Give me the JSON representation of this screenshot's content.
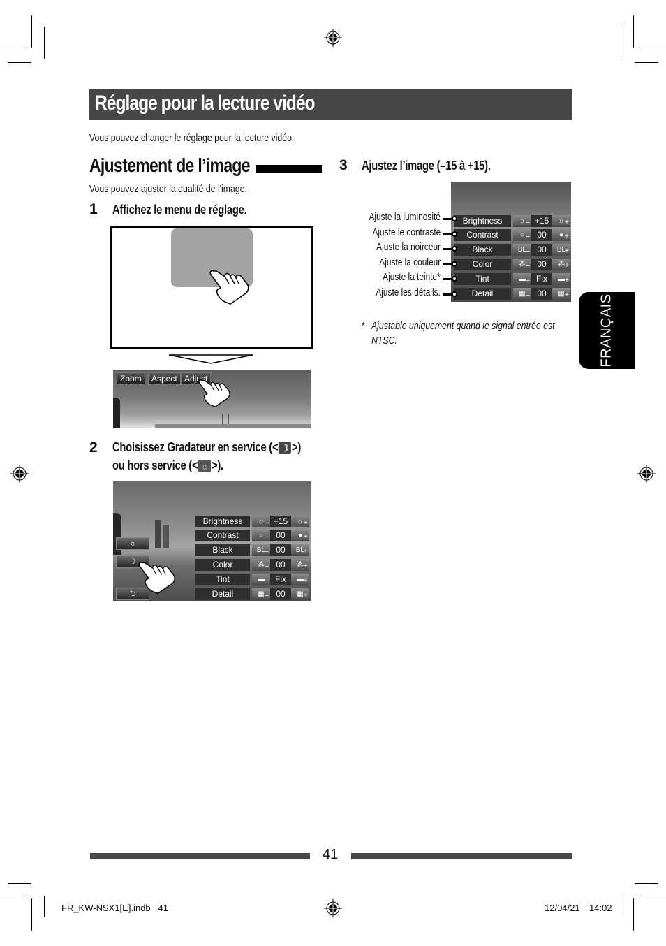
{
  "page": {
    "title": "Réglage pour la lecture vidéo",
    "intro": "Vous pouvez changer le réglage pour la lecture vidéo.",
    "language_tab": "FRANÇAIS",
    "page_number": "41"
  },
  "section": {
    "title": "Ajustement de l’image",
    "intro": "Vous pouvez ajuster la qualité de l'image."
  },
  "steps": [
    {
      "number": "1",
      "text": "Affichez le menu de réglage."
    },
    {
      "number": "2",
      "text_line1_a": "Choisissez Gradateur en service (<",
      "text_line1_b": ">)",
      "text_line2_a": "ou hors service (<",
      "text_line2_b": ">)."
    },
    {
      "number": "3",
      "text": "Ajustez l’image (–15 à +15)."
    }
  ],
  "step1_illustration": {
    "buttons": [
      "Zoom",
      "Aspect",
      "Adjust"
    ]
  },
  "adjust_menu": {
    "rows": [
      {
        "label": "Brightness",
        "minus_icon": "sun-dim-icon",
        "value": "+15",
        "plus_icon": "sun-bright-icon",
        "minus_glyph": "☼",
        "plus_glyph": "☼"
      },
      {
        "label": "Contrast",
        "minus_icon": "circle-outline-icon",
        "value": "00",
        "plus_icon": "circle-filled-icon",
        "minus_glyph": "○",
        "plus_glyph": "●"
      },
      {
        "label": "Black",
        "minus_icon": "bl-dark-icon",
        "value": "00",
        "plus_icon": "bl-light-icon",
        "minus_glyph": "BL",
        "plus_glyph": "BL"
      },
      {
        "label": "Color",
        "minus_icon": "color-dots-icon",
        "value": "00",
        "plus_icon": "color-dots-icon",
        "minus_glyph": "⁂",
        "plus_glyph": "⁂"
      },
      {
        "label": "Tint",
        "minus_icon": "tint-gradient-icon",
        "value": "Fix",
        "plus_icon": "tint-gradient-icon",
        "minus_glyph": "▬",
        "plus_glyph": "▬"
      },
      {
        "label": "Detail",
        "minus_icon": "checker-icon",
        "value": "00",
        "plus_icon": "checker-icon",
        "minus_glyph": "▦",
        "plus_glyph": "▦"
      }
    ],
    "minus_sign": "–",
    "plus_sign": "+",
    "side_buttons": {
      "dimmer_off": "☼",
      "dimmer_on": "☽",
      "back": "⮌"
    }
  },
  "callouts": [
    "Ajuste la luminosité",
    "Ajuste le contraste",
    "Ajuste la noirceur",
    "Ajuste la couleur",
    "Ajuste la teinte*",
    "Ajuste les détails."
  ],
  "footnote": {
    "marker": "*",
    "line1": "Ajustable uniquement quand le signal entrée est",
    "line2": "NTSC."
  },
  "slug": {
    "left": "FR_KW-NSX1[E].indb   41",
    "date": "12/04/21",
    "time": "14:02"
  }
}
